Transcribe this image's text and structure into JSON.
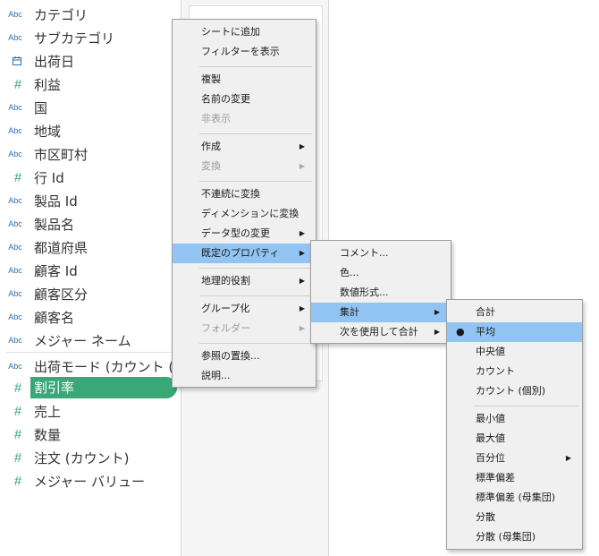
{
  "fields": [
    {
      "type": "abc",
      "icon": "Abc",
      "name": "カテゴリ"
    },
    {
      "type": "abc",
      "icon": "Abc",
      "name": "サブカテゴリ"
    },
    {
      "type": "date",
      "icon": "calendar-icon",
      "name": "出荷日"
    },
    {
      "type": "num",
      "icon": "#",
      "name": "利益"
    },
    {
      "type": "abc",
      "icon": "Abc",
      "name": "国"
    },
    {
      "type": "abc",
      "icon": "Abc",
      "name": "地域"
    },
    {
      "type": "abc",
      "icon": "Abc",
      "name": "市区町村"
    },
    {
      "type": "num",
      "icon": "#",
      "name": "行 Id"
    },
    {
      "type": "abc",
      "icon": "Abc",
      "name": "製品 Id"
    },
    {
      "type": "abc",
      "icon": "Abc",
      "name": "製品名"
    },
    {
      "type": "abc",
      "icon": "Abc",
      "name": "都道府県"
    },
    {
      "type": "abc",
      "icon": "Abc",
      "name": "顧客 Id"
    },
    {
      "type": "abc",
      "icon": "Abc",
      "name": "顧客区分"
    },
    {
      "type": "abc",
      "icon": "Abc",
      "name": "顧客名"
    },
    {
      "type": "abc",
      "icon": "Abc",
      "name": "メジャー ネーム"
    },
    {
      "type": "abc",
      "icon": "Abc",
      "name": "出荷モード (カウント (…"
    },
    {
      "type": "num",
      "icon": "#",
      "name": "割引率",
      "selected": true
    },
    {
      "type": "num",
      "icon": "#",
      "name": "売上"
    },
    {
      "type": "num",
      "icon": "#",
      "name": "数量"
    },
    {
      "type": "num",
      "icon": "#",
      "name": "注文 (カウント)"
    },
    {
      "type": "num",
      "icon": "#",
      "name": "メジャー バリュー"
    }
  ],
  "menu1": {
    "items": [
      {
        "label": "シートに追加"
      },
      {
        "label": "フィルターを表示"
      },
      {
        "sep": true
      },
      {
        "label": "複製"
      },
      {
        "label": "名前の変更"
      },
      {
        "label": "非表示",
        "disabled": true
      },
      {
        "sep": true
      },
      {
        "label": "作成",
        "sub": true
      },
      {
        "label": "変換",
        "sub": true,
        "disabled": true
      },
      {
        "sep": true
      },
      {
        "label": "不連続に変換"
      },
      {
        "label": "ディメンションに変換"
      },
      {
        "label": "データ型の変更",
        "sub": true
      },
      {
        "label": "既定のプロパティ",
        "sub": true,
        "hl": true
      },
      {
        "sep": true
      },
      {
        "label": "地理的役割",
        "sub": true
      },
      {
        "sep": true
      },
      {
        "label": "グループ化",
        "sub": true
      },
      {
        "label": "フォルダー",
        "sub": true,
        "disabled": true
      },
      {
        "sep": true
      },
      {
        "label": "参照の置換..."
      },
      {
        "label": "説明..."
      }
    ]
  },
  "menu2": {
    "items": [
      {
        "label": "コメント..."
      },
      {
        "label": "色..."
      },
      {
        "label": "数値形式..."
      },
      {
        "label": "集計",
        "sub": true,
        "hl": true
      },
      {
        "label": "次を使用して合計",
        "sub": true
      }
    ]
  },
  "menu3": {
    "items": [
      {
        "label": "合計"
      },
      {
        "label": "平均",
        "checked": true,
        "hl": true
      },
      {
        "label": "中央値"
      },
      {
        "label": "カウント"
      },
      {
        "label": "カウント (個別)"
      },
      {
        "sep": true
      },
      {
        "label": "最小値"
      },
      {
        "label": "最大値"
      },
      {
        "label": "百分位",
        "sub": true
      },
      {
        "label": "標準偏差"
      },
      {
        "label": "標準偏差 (母集団)"
      },
      {
        "label": "分散"
      },
      {
        "label": "分散 (母集団)"
      }
    ]
  },
  "colors": {
    "selected_field": "#3aa777",
    "menu_highlight": "#91c4f2",
    "menu_bg": "#f0f0f0",
    "abc_icon": "#2a6fb0",
    "measure_icon": "#3aa18a"
  }
}
